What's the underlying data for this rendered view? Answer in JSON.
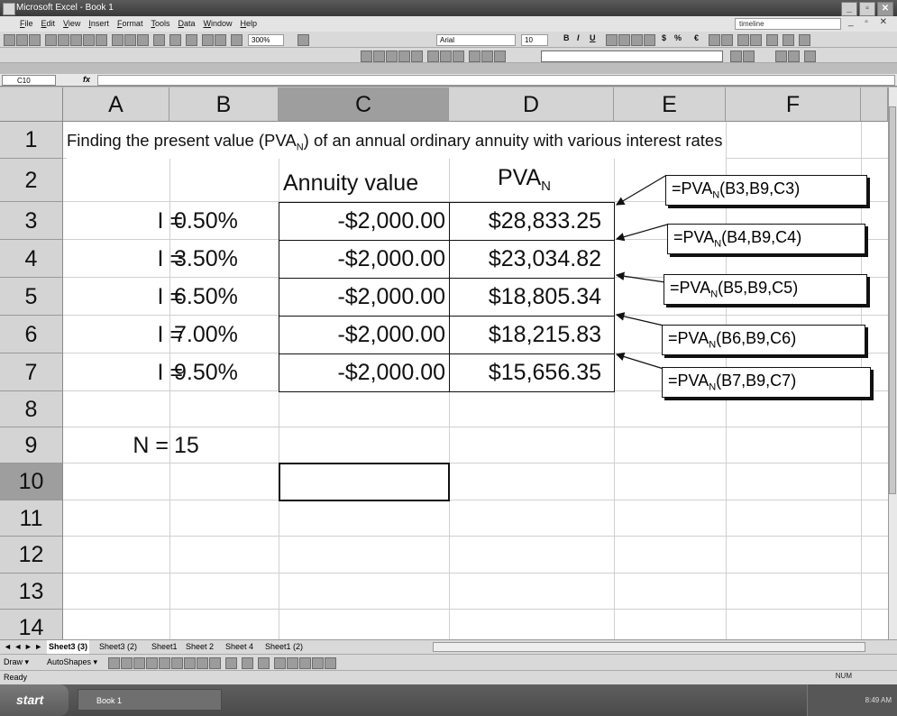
{
  "window": {
    "title": "Microsoft Excel - Book 1",
    "minimize": "_",
    "maximize": "▫",
    "close": "✕"
  },
  "menu": {
    "items": [
      "File",
      "Edit",
      "View",
      "Insert",
      "Format",
      "Tools",
      "Data",
      "Window",
      "Help"
    ],
    "help_box": "timeline",
    "controls": "_ ▫ ✕"
  },
  "toolbar": {
    "zoom": "300%",
    "font": "Arial",
    "font_size": "10",
    "bold": "B",
    "italic": "I",
    "underline": "U",
    "currency": "$",
    "percent": "%",
    "euro": "€"
  },
  "formula_bar": {
    "name_box": "C10",
    "fx": "fx",
    "formula": ""
  },
  "sheet": {
    "columns": [
      "A",
      "B",
      "C",
      "D",
      "E",
      "F"
    ],
    "rows": [
      "1",
      "2",
      "3",
      "4",
      "5",
      "6",
      "7",
      "8",
      "9",
      "10",
      "11",
      "12",
      "13",
      "14"
    ],
    "title": {
      "prefix": "Finding the present value (PVA",
      "sub": "N",
      "suffix": ") of an annual ordinary annuity with various interest rates"
    },
    "header_annuity": "Annuity value",
    "header_pva": {
      "main": "PVA",
      "sub": "N"
    },
    "rates": [
      {
        "label": "I =",
        "rate": "0.50%",
        "annuity": "-$2,000.00",
        "pva": "$28,833.25"
      },
      {
        "label": "I =",
        "rate": "3.50%",
        "annuity": "-$2,000.00",
        "pva": "$23,034.82"
      },
      {
        "label": "I =",
        "rate": "6.50%",
        "annuity": "-$2,000.00",
        "pva": "$18,805.34"
      },
      {
        "label": "I =",
        "rate": "7.00%",
        "annuity": "-$2,000.00",
        "pva": "$18,215.83"
      },
      {
        "label": "I =",
        "rate": "9.50%",
        "annuity": "-$2,000.00",
        "pva": "$15,656.35"
      }
    ],
    "n_label": "N =",
    "n_value": "15"
  },
  "callouts": [
    {
      "prefix": "=PVA",
      "sub": "N",
      "args": "(B3,B9,C3)"
    },
    {
      "prefix": "=PVA",
      "sub": "N",
      "args": "(B4,B9,C4)"
    },
    {
      "prefix": "=PVA",
      "sub": "N",
      "args": "(B5,B9,C5)"
    },
    {
      "prefix": "=PVA",
      "sub": "N",
      "args": "(B6,B9,C6)"
    },
    {
      "prefix": "=PVA",
      "sub": "N",
      "args": "(B7,B9,C7)"
    }
  ],
  "tabs": [
    "Sheet3 (3)",
    "Sheet3 (2)",
    "Sheet1",
    "Sheet 2",
    "Sheet 4",
    "Sheet1 (2)"
  ],
  "tab_nav": "◄ ◄ ► ►",
  "drawing": {
    "draw": "Draw ▾",
    "autoshapes": "AutoShapes ▾"
  },
  "status": {
    "text": "Ready",
    "num": "NUM"
  },
  "taskbar": {
    "start": "start",
    "item": "Book 1",
    "clock": "8:49 AM"
  }
}
